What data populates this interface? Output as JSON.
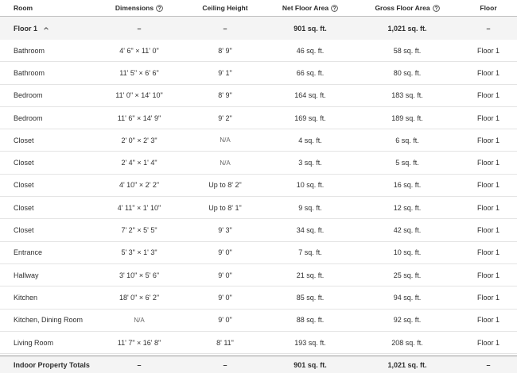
{
  "columns": {
    "room": "Room",
    "dimensions": "Dimensions",
    "ceiling": "Ceiling Height",
    "net": "Net Floor Area",
    "gross": "Gross Floor Area",
    "floor": "Floor"
  },
  "floor_group": {
    "label": "Floor 1",
    "dimensions": "–",
    "ceiling": "–",
    "net": "901 sq. ft.",
    "gross": "1,021 sq. ft.",
    "floor": "–"
  },
  "rows": [
    {
      "room": "Bathroom",
      "dimensions": "4' 6\" × 11' 0\"",
      "ceiling": "8' 9\"",
      "net": "46 sq. ft.",
      "gross": "58 sq. ft.",
      "floor": "Floor 1"
    },
    {
      "room": "Bathroom",
      "dimensions": "11' 5\" × 6' 6\"",
      "ceiling": "9' 1\"",
      "net": "66 sq. ft.",
      "gross": "80 sq. ft.",
      "floor": "Floor 1"
    },
    {
      "room": "Bedroom",
      "dimensions": "11' 0\" × 14' 10\"",
      "ceiling": "8' 9\"",
      "net": "164 sq. ft.",
      "gross": "183 sq. ft.",
      "floor": "Floor 1"
    },
    {
      "room": "Bedroom",
      "dimensions": "11' 6\" × 14' 9\"",
      "ceiling": "9' 2\"",
      "net": "169 sq. ft.",
      "gross": "189 sq. ft.",
      "floor": "Floor 1"
    },
    {
      "room": "Closet",
      "dimensions": "2' 0\" × 2' 3\"",
      "ceiling": "N/A",
      "net": "4 sq. ft.",
      "gross": "6 sq. ft.",
      "floor": "Floor 1"
    },
    {
      "room": "Closet",
      "dimensions": "2' 4\" × 1' 4\"",
      "ceiling": "N/A",
      "net": "3 sq. ft.",
      "gross": "5 sq. ft.",
      "floor": "Floor 1"
    },
    {
      "room": "Closet",
      "dimensions": "4' 10\" × 2' 2\"",
      "ceiling": "Up to 8' 2\"",
      "net": "10 sq. ft.",
      "gross": "16 sq. ft.",
      "floor": "Floor 1"
    },
    {
      "room": "Closet",
      "dimensions": "4' 11\" × 1' 10\"",
      "ceiling": "Up to 8' 1\"",
      "net": "9 sq. ft.",
      "gross": "12 sq. ft.",
      "floor": "Floor 1"
    },
    {
      "room": "Closet",
      "dimensions": "7' 2\" × 5' 5\"",
      "ceiling": "9' 3\"",
      "net": "34 sq. ft.",
      "gross": "42 sq. ft.",
      "floor": "Floor 1"
    },
    {
      "room": "Entrance",
      "dimensions": "5' 3\" × 1' 3\"",
      "ceiling": "9' 0\"",
      "net": "7 sq. ft.",
      "gross": "10 sq. ft.",
      "floor": "Floor 1"
    },
    {
      "room": "Hallway",
      "dimensions": "3' 10\" × 5' 6\"",
      "ceiling": "9' 0\"",
      "net": "21 sq. ft.",
      "gross": "25 sq. ft.",
      "floor": "Floor 1"
    },
    {
      "room": "Kitchen",
      "dimensions": "18' 0\" × 6' 2\"",
      "ceiling": "9' 0\"",
      "net": "85 sq. ft.",
      "gross": "94 sq. ft.",
      "floor": "Floor 1"
    },
    {
      "room": "Kitchen, Dining Room",
      "dimensions": "N/A",
      "ceiling": "9' 0\"",
      "net": "88 sq. ft.",
      "gross": "92 sq. ft.",
      "floor": "Floor 1"
    },
    {
      "room": "Living Room",
      "dimensions": "11' 7\" × 16' 8\"",
      "ceiling": "8' 11\"",
      "net": "193 sq. ft.",
      "gross": "208 sq. ft.",
      "floor": "Floor 1"
    }
  ],
  "totals": {
    "label": "Indoor Property Totals",
    "dimensions": "–",
    "ceiling": "–",
    "net": "901 sq. ft.",
    "gross": "1,021 sq. ft.",
    "floor": "–"
  },
  "icons": {
    "info": "question-circle-icon",
    "toggle": "chevron-up-icon"
  }
}
